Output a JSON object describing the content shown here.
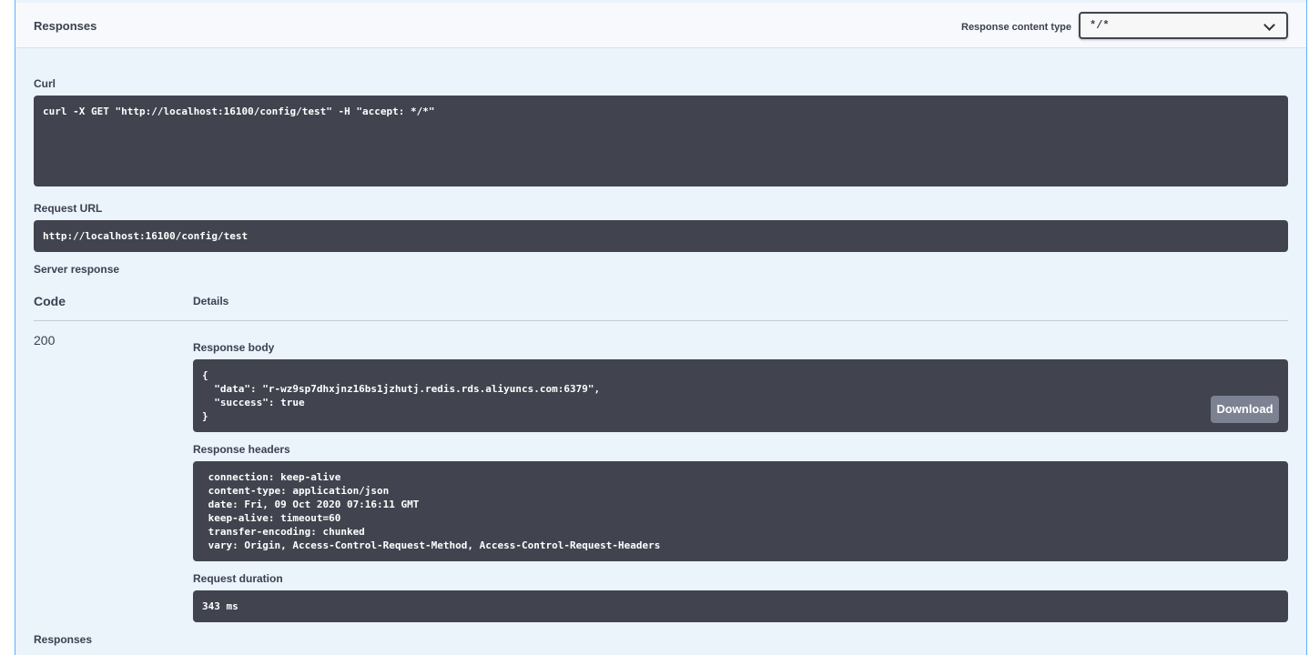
{
  "responses_header": {
    "title": "Responses",
    "content_type_label": "Response content type",
    "content_type_value": "*/*"
  },
  "curl": {
    "label": "Curl",
    "command": "curl -X GET \"http://localhost:16100/config/test\" -H \"accept: */*\""
  },
  "request_url": {
    "label": "Request URL",
    "value": "http://localhost:16100/config/test"
  },
  "server_response": {
    "label": "Server response",
    "col_code": "Code",
    "col_details": "Details",
    "status_code": "200",
    "body_label": "Response body",
    "body": "{\n  \"data\": \"r-wz9sp7dhxjnz16bs1jzhutj.redis.rds.aliyuncs.com:6379\",\n  \"success\": true\n}",
    "download_label": "Download",
    "headers_label": "Response headers",
    "headers": " connection: keep-alive\n content-type: application/json\n date: Fri, 09 Oct 2020 07:16:11 GMT\n keep-alive: timeout=60\n transfer-encoding: chunked\n vary: Origin, Access-Control-Request-Method, Access-Control-Request-Headers",
    "duration_label": "Request duration",
    "duration": "343 ms"
  },
  "next_section_title": "Responses",
  "colors": {
    "accent_border": "#61affe",
    "panel_bg": "#ebf3fb",
    "code_bg": "#41444e",
    "download_bg": "#7d8293"
  }
}
